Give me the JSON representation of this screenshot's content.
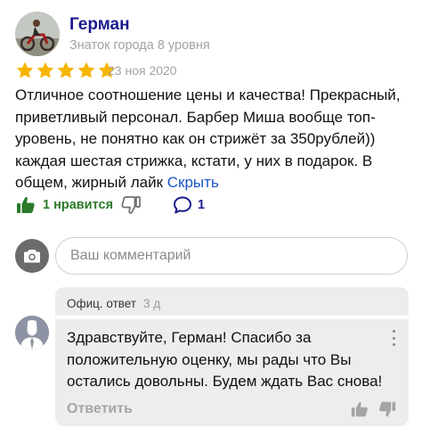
{
  "review": {
    "author_name": "Герман",
    "author_level": "Знаток города 8 уровня",
    "rating": 5,
    "date": "23 ноя 2020",
    "text": "Отличное соотношение цены и качества! Прекрасный, приветливый персонал. Барбер Миша вообще топ-уровень, не понятно как он стрижёт за 350рублей)) каждая шестая стрижка, кстати, у них в подарок. В общем, жирный лайк ",
    "hide_link": "Скрыть",
    "likes_label": "1 нравится",
    "comments_count": "1",
    "colors": {
      "author": "#1b1b8c",
      "star": "#f7b500",
      "like": "#2a7a2a",
      "link": "#1a56c6"
    }
  },
  "comment_input": {
    "placeholder": "Ваш комментарий"
  },
  "reply": {
    "label": "Офиц. ответ",
    "time": "3 д",
    "text": "Здравствуйте, Герман! Спасибо за положительную оценку, мы рады что Вы остались довольны. Будем ждать Вас снова!",
    "reply_button": "Ответить"
  }
}
